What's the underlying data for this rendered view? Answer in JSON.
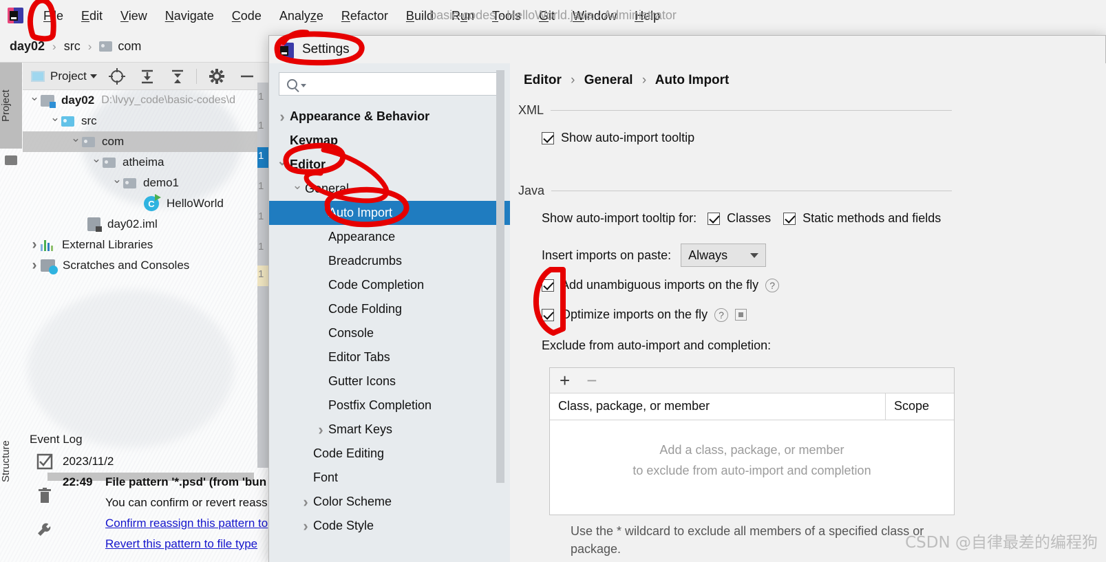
{
  "window": {
    "title": "basic-codes - HelloWorld.java - Administrator",
    "logo_icon": "intellij-idea-logo-icon"
  },
  "menubar": {
    "items": [
      {
        "label": "File"
      },
      {
        "label": "Edit"
      },
      {
        "label": "View"
      },
      {
        "label": "Navigate"
      },
      {
        "label": "Code"
      },
      {
        "label": "Analyze"
      },
      {
        "label": "Refactor"
      },
      {
        "label": "Build"
      },
      {
        "label": "Run"
      },
      {
        "label": "Tools"
      },
      {
        "label": "Git"
      },
      {
        "label": "Window"
      },
      {
        "label": "Help"
      }
    ]
  },
  "breadcrumb": {
    "items": [
      {
        "label": "day02",
        "icon": ""
      },
      {
        "label": "src",
        "icon": ""
      },
      {
        "label": "com",
        "icon": "folder-icon"
      }
    ],
    "separator": "›"
  },
  "toolstrip": {
    "project_label": "Project",
    "structure_label": "Structure"
  },
  "project_panel": {
    "toolbar": {
      "title": "Project",
      "icons": [
        "locate-target-icon",
        "expand-all-icon",
        "collapse-all-icon",
        "gear-icon",
        "hide-icon"
      ]
    },
    "tree": [
      {
        "label": "day02",
        "path": "D:\\lvyy_code\\basic-codes\\d",
        "depth": 0,
        "chevron": "down",
        "icon": "module-icon",
        "bold": true
      },
      {
        "label": "src",
        "path": "",
        "depth": 1,
        "chevron": "down",
        "icon": "source-folder-icon",
        "bold": false
      },
      {
        "label": "com",
        "path": "",
        "depth": 2,
        "chevron": "down",
        "icon": "package-folder-icon",
        "bold": false,
        "selected": true
      },
      {
        "label": "atheima",
        "path": "",
        "depth": 3,
        "chevron": "down",
        "icon": "package-folder-icon",
        "bold": false
      },
      {
        "label": "demo1",
        "path": "",
        "depth": 4,
        "chevron": "down",
        "icon": "package-folder-icon",
        "bold": false
      },
      {
        "label": "HelloWorld",
        "path": "",
        "depth": 5,
        "chevron": "none",
        "icon": "java-class-runnable-icon",
        "bold": false
      },
      {
        "label": "day02.iml",
        "path": "",
        "depth": 2,
        "chevron": "none",
        "icon": "iml-file-icon",
        "bold": false
      },
      {
        "label": "External Libraries",
        "path": "",
        "depth": 0,
        "chevron": "right",
        "icon": "libraries-icon",
        "bold": false
      },
      {
        "label": "Scratches and Consoles",
        "path": "",
        "depth": 0,
        "chevron": "right",
        "icon": "scratches-icon",
        "bold": false
      }
    ]
  },
  "event_log": {
    "title": "Event Log",
    "side_icons": [
      "mark-read-icon",
      "trash-icon",
      "settings-wrench-icon"
    ],
    "entries": [
      {
        "date": "2023/11/2",
        "time": "",
        "text": "",
        "kind": "date"
      },
      {
        "date": "",
        "time": "22:49",
        "text": "File pattern '*.psd' (from 'bun",
        "kind": "bold"
      },
      {
        "date": "",
        "time": "",
        "text": "You can confirm or revert reass",
        "kind": "plain"
      },
      {
        "date": "",
        "time": "",
        "text": "Confirm reassign this pattern to",
        "kind": "link"
      },
      {
        "date": "",
        "time": "",
        "text": "Revert this pattern to file type ",
        "kind": "link"
      }
    ]
  },
  "editor_gutter": {
    "line_numbers": [
      "1",
      "1",
      "1",
      "1",
      "1",
      "1",
      "1",
      "1"
    ]
  },
  "settings_dialog": {
    "title": "Settings",
    "logo_icon": "intellij-idea-logo-icon",
    "search": {
      "placeholder": "",
      "value": "",
      "icon": "search-icon"
    },
    "nav": [
      {
        "label": "Appearance & Behavior",
        "depth": 0,
        "chevron": "right",
        "bold": true
      },
      {
        "label": "Keymap",
        "depth": 0,
        "chevron": "none",
        "bold": true
      },
      {
        "label": "Editor",
        "depth": 0,
        "chevron": "down",
        "bold": true
      },
      {
        "label": "General",
        "depth": 1,
        "chevron": "down",
        "bold": false
      },
      {
        "label": "Auto Import",
        "depth": 2,
        "chevron": "none",
        "bold": false,
        "active": true
      },
      {
        "label": "Appearance",
        "depth": 2,
        "chevron": "none",
        "bold": false
      },
      {
        "label": "Breadcrumbs",
        "depth": 2,
        "chevron": "none",
        "bold": false
      },
      {
        "label": "Code Completion",
        "depth": 2,
        "chevron": "none",
        "bold": false
      },
      {
        "label": "Code Folding",
        "depth": 2,
        "chevron": "none",
        "bold": false
      },
      {
        "label": "Console",
        "depth": 2,
        "chevron": "none",
        "bold": false
      },
      {
        "label": "Editor Tabs",
        "depth": 2,
        "chevron": "none",
        "bold": false
      },
      {
        "label": "Gutter Icons",
        "depth": 2,
        "chevron": "none",
        "bold": false
      },
      {
        "label": "Postfix Completion",
        "depth": 2,
        "chevron": "none",
        "bold": false
      },
      {
        "label": "Smart Keys",
        "depth": 2,
        "chevron": "right",
        "bold": false
      },
      {
        "label": "Code Editing",
        "depth": 1,
        "chevron": "none",
        "bold": false
      },
      {
        "label": "Font",
        "depth": 1,
        "chevron": "none",
        "bold": false
      },
      {
        "label": "Color Scheme",
        "depth": 1,
        "chevron": "right",
        "bold": false
      },
      {
        "label": "Code Style",
        "depth": 1,
        "chevron": "right",
        "bold": false
      }
    ],
    "content": {
      "breadcrumb": [
        "Editor",
        "General",
        "Auto Import"
      ],
      "breadcrumb_separator": "›",
      "xml_section": {
        "label": "XML",
        "show_tooltip": {
          "label": "Show auto-import tooltip",
          "checked": true
        }
      },
      "java_section": {
        "label": "Java",
        "tooltip_for_label": "Show auto-import tooltip for:",
        "tooltip_for_options": [
          {
            "label": "Classes",
            "checked": true
          },
          {
            "label": "Static methods and fields",
            "checked": true
          }
        ],
        "insert_imports_label": "Insert imports on paste:",
        "insert_imports_value": "Always",
        "add_unambiguous": {
          "label": "Add unambiguous imports on the fly",
          "checked": true,
          "help": "?"
        },
        "optimize_imports": {
          "label": "Optimize imports on the fly",
          "checked": true,
          "help": "?"
        },
        "exclude_label": "Exclude from auto-import and completion:",
        "table": {
          "add_button": "+",
          "remove_button": "−",
          "columns": [
            "Class, package, or member",
            "Scope"
          ],
          "empty_lines": [
            "Add a class, package, or member",
            "to exclude from auto-import and completion"
          ]
        },
        "footer_lines": [
          "Use the * wildcard to exclude all members of a specified class or",
          "package."
        ]
      }
    }
  },
  "watermark": {
    "text": "CSDN @自律最差的编程狗"
  },
  "colors": {
    "accent_blue": "#1f7cc0",
    "annotation_red": "#e60000",
    "title_gray": "#a0a0a0",
    "dialog_bg": "#f1f1f1",
    "nav_bg": "#e7ebee"
  }
}
